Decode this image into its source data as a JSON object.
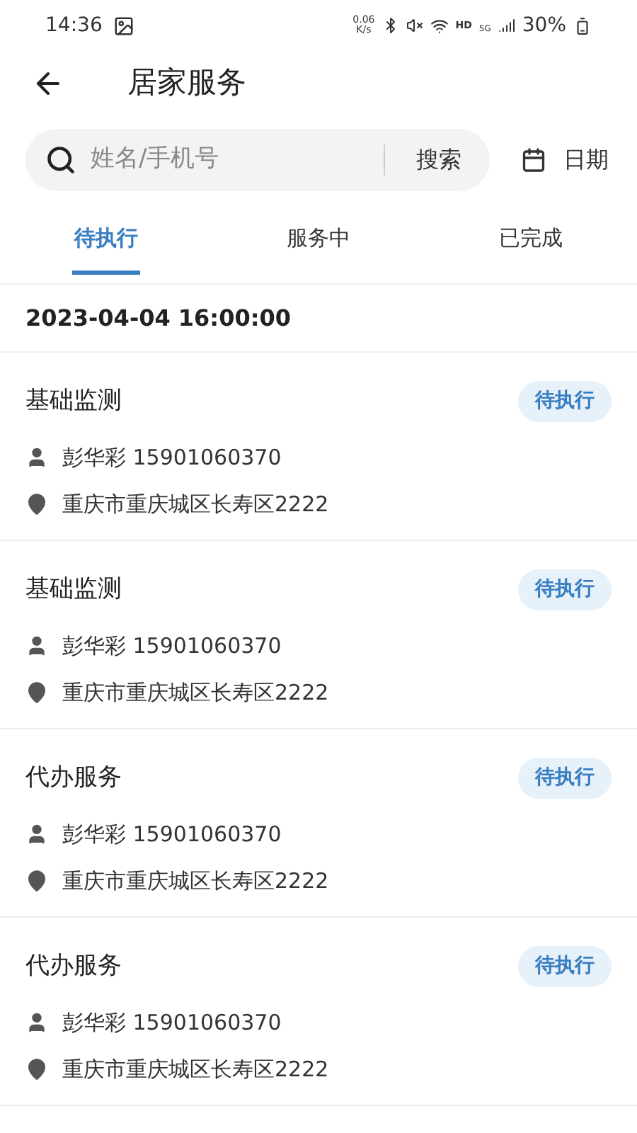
{
  "status_bar": {
    "time": "14:36",
    "speed_value": "0.06",
    "speed_unit": "K/s",
    "hd": "HD",
    "network": "5G",
    "battery": "30%"
  },
  "header": {
    "title": "居家服务"
  },
  "search": {
    "placeholder": "姓名/手机号",
    "button": "搜索",
    "date_label": "日期"
  },
  "tabs": [
    {
      "label": "待执行",
      "selected": true
    },
    {
      "label": "服务中",
      "selected": false
    },
    {
      "label": "已完成",
      "selected": false
    }
  ],
  "date_group": "2023-04-04 16:00:00",
  "orders": [
    {
      "title": "基础监测",
      "status": "待执行",
      "person": "彭华彩 15901060370",
      "address": "重庆市重庆城区长寿区2222"
    },
    {
      "title": "基础监测",
      "status": "待执行",
      "person": "彭华彩 15901060370",
      "address": "重庆市重庆城区长寿区2222"
    },
    {
      "title": "代办服务",
      "status": "待执行",
      "person": "彭华彩 15901060370",
      "address": "重庆市重庆城区长寿区2222"
    },
    {
      "title": "代办服务",
      "status": "待执行",
      "person": "彭华彩 15901060370",
      "address": "重庆市重庆城区长寿区2222"
    }
  ]
}
